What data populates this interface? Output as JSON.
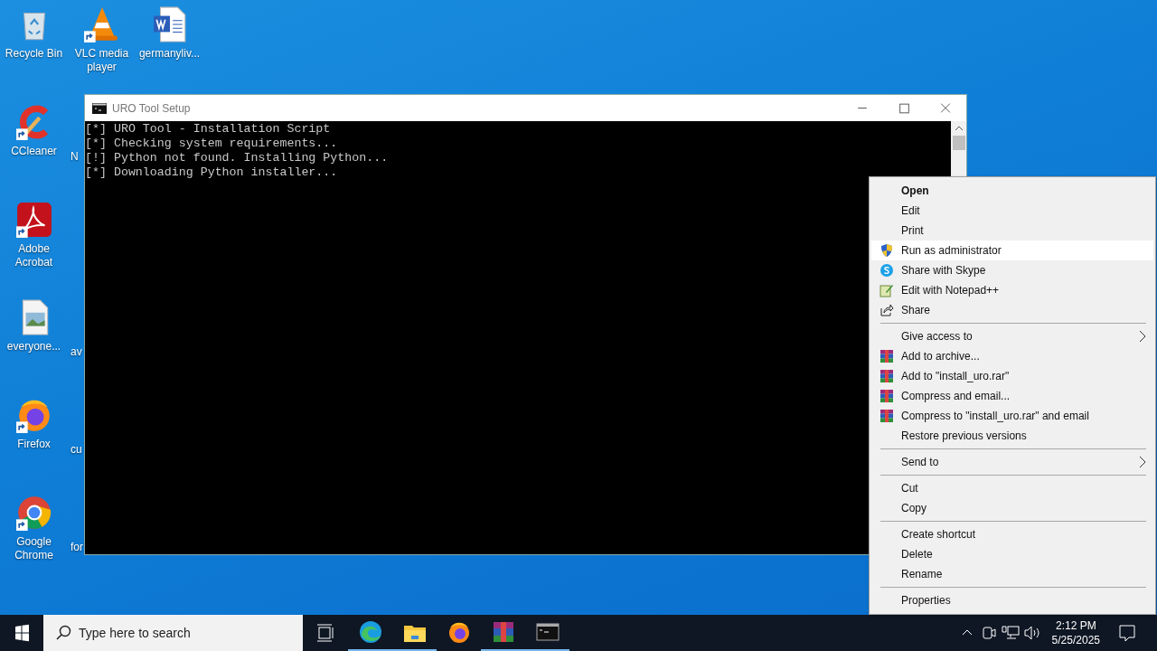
{
  "desktop_icons": [
    {
      "label": "Recycle Bin",
      "kind": "icon"
    },
    {
      "label": "CCleaner",
      "kind": "icon"
    },
    {
      "label": "Adobe Acrobat",
      "kind": "icon"
    },
    {
      "label": "everyone...",
      "kind": "icon"
    },
    {
      "label": "Firefox",
      "kind": "icon"
    },
    {
      "label": "Google Chrome",
      "kind": "icon"
    },
    {
      "label": "VLC media player",
      "kind": "icon"
    },
    {
      "label": "N",
      "kind": "covered"
    },
    {
      "kind": "covered"
    },
    {
      "label": "av",
      "kind": "covered"
    },
    {
      "label": "cu",
      "kind": "covered"
    },
    {
      "label": "for",
      "kind": "covered"
    },
    {
      "label": "germanyliv...",
      "kind": "icon"
    }
  ],
  "console_window": {
    "title": "URO Tool Setup",
    "lines": [
      "[*] URO Tool - Installation Script",
      "[*] Checking system requirements...",
      "[!] Python not found. Installing Python...",
      "[*] Downloading Python installer..."
    ]
  },
  "context_menu": [
    {
      "kind": "item",
      "label": "Open",
      "default": true,
      "selected": false
    },
    {
      "kind": "item",
      "label": "Edit",
      "selected": false
    },
    {
      "kind": "item",
      "label": "Print",
      "selected": false
    },
    {
      "kind": "item",
      "label": "Run as administrator",
      "selected": true
    },
    {
      "kind": "item",
      "label": "Share with Skype",
      "selected": false
    },
    {
      "kind": "item",
      "label": "Edit with Notepad++",
      "selected": false
    },
    {
      "kind": "item",
      "label": "Share",
      "selected": false
    },
    {
      "kind": "separator"
    },
    {
      "kind": "item",
      "label": "Give access to",
      "submenu": true,
      "selected": false
    },
    {
      "kind": "item",
      "label": "Add to archive...",
      "selected": false
    },
    {
      "kind": "item",
      "label": "Add to \"install_uro.rar\"",
      "selected": false
    },
    {
      "kind": "item",
      "label": "Compress and email...",
      "selected": false
    },
    {
      "kind": "item",
      "label": "Compress to \"install_uro.rar\" and email",
      "selected": false
    },
    {
      "kind": "item",
      "label": "Restore previous versions",
      "selected": false
    },
    {
      "kind": "separator"
    },
    {
      "kind": "item",
      "label": "Send to",
      "submenu": true,
      "selected": false
    },
    {
      "kind": "separator"
    },
    {
      "kind": "item",
      "label": "Cut",
      "selected": false
    },
    {
      "kind": "item",
      "label": "Copy",
      "selected": false
    },
    {
      "kind": "separator"
    },
    {
      "kind": "item",
      "label": "Create shortcut",
      "selected": false
    },
    {
      "kind": "item",
      "label": "Delete",
      "selected": false
    },
    {
      "kind": "item",
      "label": "Rename",
      "selected": false
    },
    {
      "kind": "separator"
    },
    {
      "kind": "item",
      "label": "Properties",
      "selected": false
    }
  ],
  "taskbar": {
    "search": {
      "placeholder": "Type here to search"
    },
    "apps": [
      {
        "running": true
      },
      {
        "running": true
      },
      {
        "running": false
      },
      {
        "running": true
      },
      {
        "running": true
      }
    ],
    "clock": {
      "time": "2:12 PM",
      "date": "5/25/2025"
    }
  }
}
